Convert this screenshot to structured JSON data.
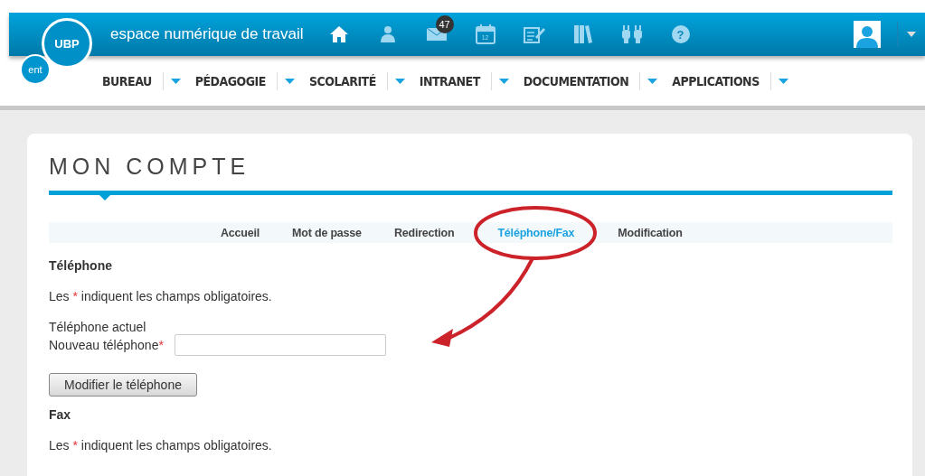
{
  "header": {
    "title": "espace numérique de travail",
    "logo": {
      "main": "UBP",
      "badge": "ent"
    },
    "icons": [
      {
        "kind": "home"
      },
      {
        "kind": "user"
      },
      {
        "kind": "mail",
        "badge": "47"
      },
      {
        "kind": "calendar",
        "badge": "12"
      },
      {
        "kind": "edit"
      },
      {
        "kind": "books"
      },
      {
        "kind": "plug"
      },
      {
        "kind": "help",
        "badge": "?"
      }
    ]
  },
  "nav": [
    "BUREAU",
    "PÉDAGOGIE",
    "SCOLARITÉ",
    "INTRANET",
    "DOCUMENTATION",
    "APPLICATIONS"
  ],
  "page": {
    "title": "MON COMPTE",
    "tabs": [
      {
        "label": "Accueil",
        "selected": false
      },
      {
        "label": "Mot de passe",
        "selected": false
      },
      {
        "label": "Redirection",
        "selected": false
      },
      {
        "label": "Téléphone/Fax",
        "selected": true
      },
      {
        "label": "Modification",
        "selected": false
      }
    ],
    "sections": [
      {
        "heading": "Téléphone",
        "note": {
          "before": "Les",
          "mark": "*",
          "after": "indiquent les champs obligatoires."
        },
        "current_label": "Téléphone actuel",
        "field_label": "Nouveau téléphone",
        "required_mark": "*",
        "button": "Modifier le téléphone"
      },
      {
        "heading": "Fax",
        "note": {
          "before": "Les",
          "mark": "*",
          "after": "indiquent les champs obligatoires."
        }
      }
    ]
  }
}
